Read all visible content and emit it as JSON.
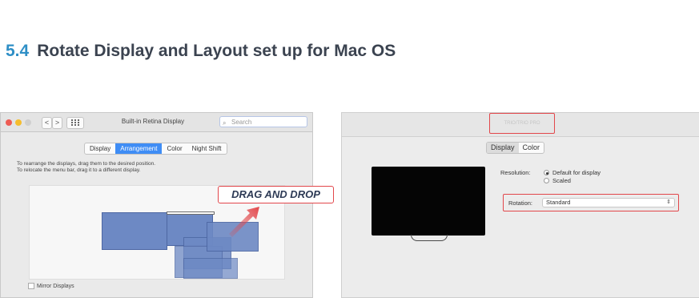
{
  "heading": {
    "number": "5.4",
    "text": "Rotate Display and Layout set up for Mac OS"
  },
  "left_window": {
    "title": "Built-in Retina Display",
    "search_placeholder": "Search",
    "nav_back": "<",
    "nav_forward": ">",
    "grid_icon": "grid-icon",
    "tabs": [
      "Display",
      "Arrangement",
      "Color",
      "Night Shift"
    ],
    "active_tab": "Arrangement",
    "instructions": [
      "To rearrange the displays, drag them to the desired position.",
      "To relocate the menu bar, drag it to a different display."
    ],
    "mirror_label": "Mirror Displays"
  },
  "callout": {
    "text": "DRAG AND DROP"
  },
  "right_window": {
    "display_name": "TRIO/TRIO PRO",
    "tabs": [
      "Display",
      "Color"
    ],
    "resolution_label": "Resolution:",
    "resolution_options": [
      "Default for display",
      "Scaled"
    ],
    "selected_resolution": "Default for display",
    "rotation_label": "Rotation:",
    "rotation_value": "Standard"
  },
  "colors": {
    "accent_blue": "#2f8fc6",
    "highlight_red": "#e2474b",
    "display_blue": "#6d89c4"
  }
}
